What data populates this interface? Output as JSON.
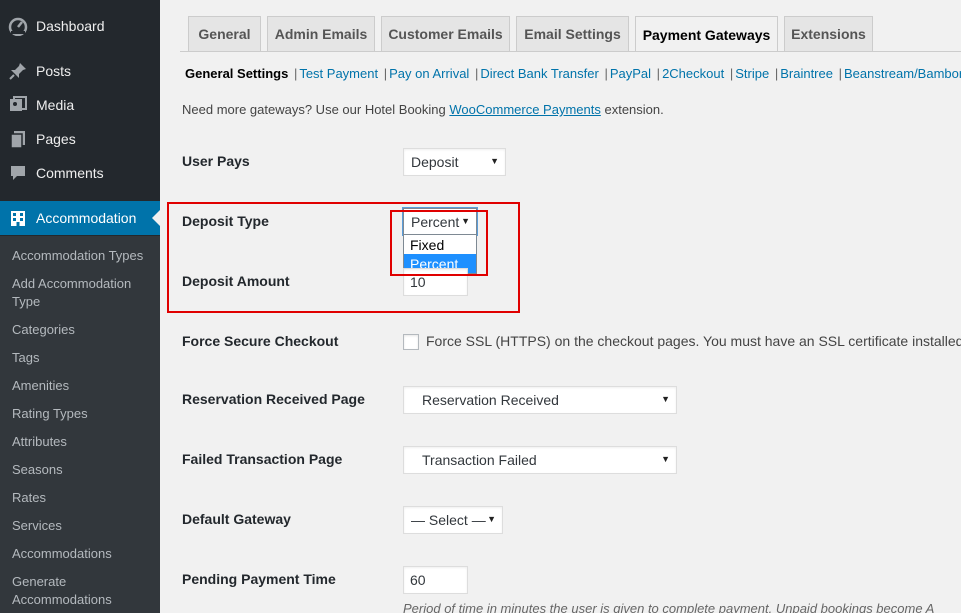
{
  "sidebar": {
    "items": [
      {
        "label": "Dashboard",
        "icon": "dashboard-icon"
      },
      {
        "label": "Posts",
        "icon": "pin-icon"
      },
      {
        "label": "Media",
        "icon": "media-icon"
      },
      {
        "label": "Pages",
        "icon": "pages-icon"
      },
      {
        "label": "Comments",
        "icon": "comments-icon"
      },
      {
        "label": "Accommodation",
        "icon": "building-icon",
        "current": true
      }
    ],
    "submenu": [
      "Accommodation Types",
      "Add Accommodation Type",
      "Categories",
      "Tags",
      "Amenities",
      "Rating Types",
      "Attributes",
      "Seasons",
      "Rates",
      "Services",
      "Accommodations",
      "Generate Accommodations"
    ],
    "colors": {
      "background": "#23282d",
      "current": "#0073aa"
    }
  },
  "tabs": [
    "General",
    "Admin Emails",
    "Customer Emails",
    "Email Settings",
    "Payment Gateways",
    "Extensions"
  ],
  "active_tab": "Payment Gateways",
  "subsections": {
    "current": "General Settings",
    "links": [
      "Test Payment",
      "Pay on Arrival",
      "Direct Bank Transfer",
      "PayPal",
      "2Checkout",
      "Stripe",
      "Braintree",
      "Beanstream/Bambora"
    ]
  },
  "intro": {
    "before": "Need more gateways? Use our Hotel Booking ",
    "link": "WooCommerce Payments",
    "after": " extension."
  },
  "settings": {
    "user_pays": {
      "label": "User Pays",
      "value": "Deposit"
    },
    "deposit_type": {
      "label": "Deposit Type",
      "value": "Percent",
      "options": [
        "Fixed",
        "Percent"
      ],
      "selected": "Percent"
    },
    "deposit_amount": {
      "label": "Deposit Amount",
      "value": "10"
    },
    "force_secure": {
      "label": "Force Secure Checkout",
      "description": "Force SSL (HTTPS) on the checkout pages. You must have an SSL certificate installed to",
      "checked": false
    },
    "reservation_page": {
      "label": "Reservation Received Page",
      "value": "Reservation Received"
    },
    "failed_page": {
      "label": "Failed Transaction Page",
      "value": "Transaction Failed"
    },
    "default_gateway": {
      "label": "Default Gateway",
      "value": "— Select —"
    },
    "pending_time": {
      "label": "Pending Payment Time",
      "value": "60",
      "description": "Period of time in minutes the user is given to complete payment. Unpaid bookings become A"
    }
  },
  "colors": {
    "highlight_box": "#e00000",
    "link": "#0073aa",
    "selected_option": "#1e90ff"
  }
}
